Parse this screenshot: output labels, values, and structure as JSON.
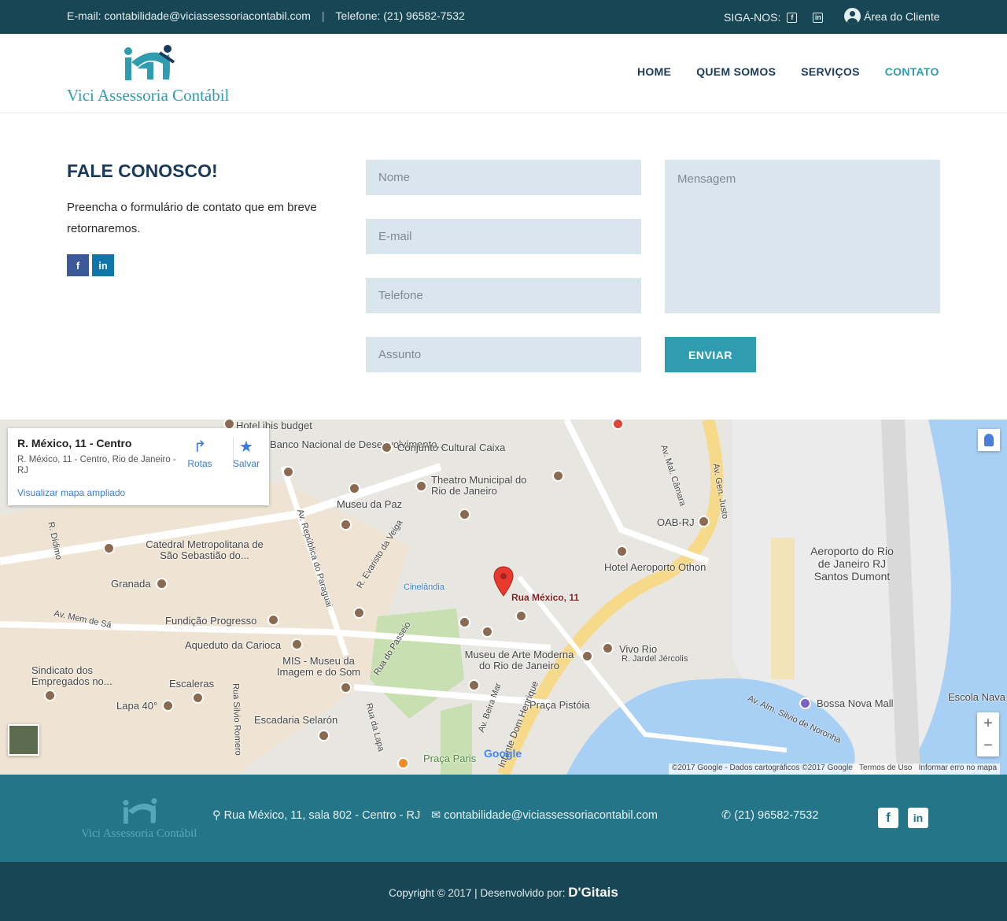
{
  "topbar": {
    "email": "E-mail: contabilidade@viciassessoriacontabil.com",
    "separator": "|",
    "phone": "Telefone: (21) 96582-7532",
    "follow_label": "SIGA-NOS:",
    "client_area": "Área do Cliente"
  },
  "brand": {
    "name": "Vici Assessoria Contábil",
    "accent": "#2f9cb0",
    "dark": "#174654"
  },
  "nav": {
    "items": [
      {
        "label": "HOME"
      },
      {
        "label": "QUEM SOMOS"
      },
      {
        "label": "SERVIÇOS"
      },
      {
        "label": "CONTATO"
      }
    ],
    "active": "CONTATO"
  },
  "contact": {
    "title": "FALE CONOSCO!",
    "text": "Preencha o formulário de contato que em breve retornaremos.",
    "form": {
      "name_placeholder": "Nome",
      "email_placeholder": "E-mail",
      "phone_placeholder": "Telefone",
      "subject_placeholder": "Assunto",
      "message_placeholder": "Mensagem",
      "submit_label": "ENVIAR"
    }
  },
  "map": {
    "card": {
      "title": "R. México, 11 - Centro",
      "address": "R. México, 11 - Centro, Rio de Janeiro - RJ",
      "enlarge": "Visualizar mapa ampliado",
      "directions": "Rotas",
      "save": "Salvar"
    },
    "pin_label": "Rua México, 11",
    "labels": [
      "Hotel ibis budget",
      "Banco Nacional de Desenvolvimento...",
      "Conjunto Cultural Caixa",
      "Theatro Municipal do Rio de Janeiro",
      "Museu da Paz",
      "OAB-RJ",
      "Aeroporto do Rio de Janeiro RJ Santos Dumont",
      "Catedral Metropolitana de São Sebastião do...",
      "Hotel Aeroporto Othon",
      "Granada",
      "Cinelândia",
      "Fundição Progresso",
      "Aqueduto da Carioca",
      "MIS - Museu da Imagem e do Som",
      "Museu de Arte Moderna do Rio de Janeiro",
      "Vivo Rio",
      "R. Jardel Jércolis",
      "Sindicato dos Empregados no...",
      "Escaleras",
      "Lapa 40°",
      "Escadaria Selarón",
      "Praça Pistóia",
      "Bossa Nova Mall",
      "Escola Nava",
      "Praça Paris",
      "Av. Gen. Justo",
      "Av. Mal. Câmara",
      "Av. República do Paraguai",
      "R. Evaristo da Veiga",
      "Av. Mem de Sá",
      "Rua do Passeio",
      "Av. Beira Mar",
      "Infante Dom Henrique",
      "Rua da Lapa",
      "Rua Silvio Romero",
      "Av. Alm. Silvio de Noronha",
      "R. Dídimo"
    ],
    "credit": "©2017 Google - Dados cartográficos ©2017 Google",
    "terms": "Termos de Uso",
    "report": "Informar erro no mapa",
    "google": "Google"
  },
  "footer": {
    "address": "Rua México, 11, sala 802 - Centro - RJ",
    "email": "contabilidade@viciassessoriacontabil.com",
    "phone": "(21) 96582-7532",
    "copyright": "Copyright © 2017 | Desenvolvido por:",
    "developer": "D'Gitais"
  }
}
